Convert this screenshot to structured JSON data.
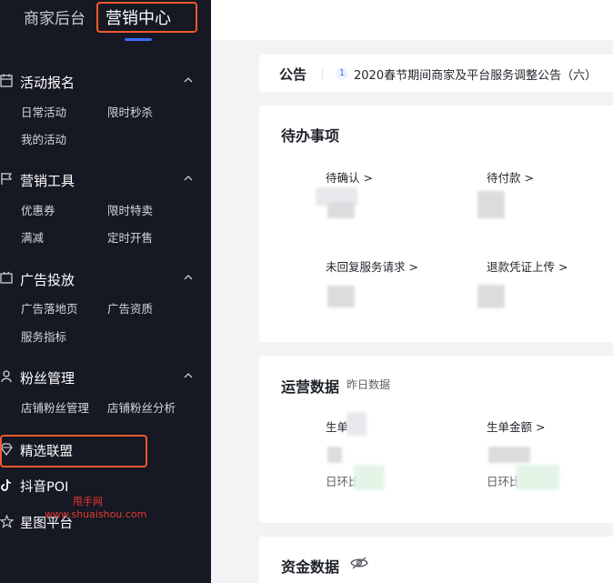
{
  "sidebar": {
    "tabs": {
      "merchant": "商家后台",
      "marketing": "营销中心"
    },
    "groups": [
      {
        "title": "活动报名",
        "icon": "calendar-icon",
        "items": [
          "日常活动",
          "限时秒杀",
          "我的活动"
        ]
      },
      {
        "title": "营销工具",
        "icon": "flag-icon",
        "items": [
          "优惠券",
          "限时特卖",
          "满减",
          "定时开售"
        ]
      },
      {
        "title": "广告投放",
        "icon": "ad-icon",
        "items": [
          "广告落地页",
          "广告资质",
          "服务指标"
        ]
      },
      {
        "title": "粉丝管理",
        "icon": "fans-icon",
        "items": [
          "店铺粉丝管理",
          "店铺粉丝分析"
        ]
      }
    ],
    "singles": [
      {
        "title": "精选联盟",
        "icon": "diamond-icon"
      },
      {
        "title": "抖音POI",
        "icon": "tiktok-icon"
      },
      {
        "title": "星图平台",
        "icon": "star-icon"
      }
    ],
    "watermark": {
      "line1": "甩手网",
      "line2": "www.shuaishou.com"
    }
  },
  "notice": {
    "title": "公告",
    "number": "1",
    "text": "2020春节期间商家及平台服务调整公告（六）"
  },
  "todo": {
    "title": "待办事项",
    "items": [
      "待确认 >",
      "待付款 >",
      "未回复服务请求 >",
      "退款凭证上传 >"
    ]
  },
  "ops": {
    "title": "运营数据",
    "subtitle": "昨日数据",
    "items": [
      "生单",
      "生单金额 >"
    ],
    "compare": [
      "日环比",
      "日环比"
    ]
  },
  "funds": {
    "title": "资金数据"
  },
  "colors": {
    "sidebar_bg": "#161823",
    "accent": "#3a6cff",
    "highlight": "#f25a2c"
  }
}
